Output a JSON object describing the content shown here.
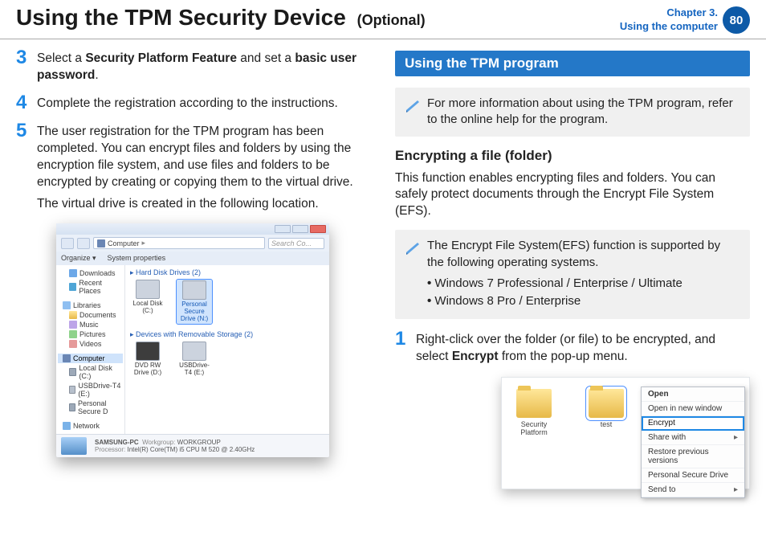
{
  "header": {
    "title": "Using the TPM Security Device",
    "suffix": "(Optional)",
    "chapter_line1": "Chapter 3.",
    "chapter_line2": "Using the computer",
    "page": "80"
  },
  "left": {
    "step3": {
      "num": "3",
      "text_a": "Select a ",
      "b1": "Security Platform Feature",
      "text_b": " and set a ",
      "b2": "basic user password",
      "text_c": "."
    },
    "step4": {
      "num": "4",
      "text": "Complete the registration according to the instructions."
    },
    "step5": {
      "num": "5",
      "p1": "The user registration for the TPM program has been completed. You can encrypt files and folders by using the encryption file system, and use files and folders to be encrypted by creating or copying them to the virtual drive.",
      "p2": "The virtual drive is created in the following location."
    },
    "explorer": {
      "breadcrumb_root": "Computer",
      "search_placeholder": "Search Co...",
      "toolbar_organize": "Organize ▾",
      "toolbar_props": "System properties",
      "nav": {
        "downloads": "Downloads",
        "recent": "Recent Places",
        "libraries": "Libraries",
        "documents": "Documents",
        "music": "Music",
        "pictures": "Pictures",
        "videos": "Videos",
        "computer": "Computer",
        "local_c": "Local Disk (C:)",
        "usbt4": "USBDrive-T4 (E:)",
        "psd": "Personal Secure D",
        "network": "Network"
      },
      "section_hdd": "Hard Disk Drives (2)",
      "section_rem": "Devices with Removable Storage (2)",
      "drives": {
        "local_c": "Local Disk (C:)",
        "psd": "Personal Secure Drive (N:)",
        "dvd": "DVD RW Drive (D:)",
        "usb": "USBDrive-T4 (E:)"
      },
      "status": {
        "pc_name": "SAMSUNG-PC",
        "wg_label": "Workgroup:",
        "wg_value": "WORKGROUP",
        "proc_label": "Processor:",
        "proc_value": "Intel(R) Core(TM) i5 CPU     M 520  @ 2.40GHz"
      }
    }
  },
  "right": {
    "banner": "Using the TPM program",
    "note1": "For more information about using the TPM program, refer to the online help for the program.",
    "subhead": "Encrypting a file (folder)",
    "para": "This function enables encrypting files and folders. You can safely protect documents through the Encrypt File System (EFS).",
    "note2": {
      "lead": "The Encrypt File System(EFS) function is supported by the following operating systems.",
      "li1": "Windows 7 Professional / Enterprise / Ultimate",
      "li2": "Windows 8 Pro / Enterprise"
    },
    "step1": {
      "num": "1",
      "text_a": "Right-click over the folder (or file) to be encrypted, and select ",
      "b1": "Encrypt",
      "text_b": " from the pop-up menu."
    },
    "shot2": {
      "folder1": "Security Platform",
      "folder2": "test",
      "menu": {
        "open": "Open",
        "open_new": "Open in new window",
        "encrypt": "Encrypt",
        "share": "Share with",
        "restore": "Restore previous versions",
        "psd": "Personal Secure Drive",
        "sendto": "Send to"
      }
    }
  }
}
